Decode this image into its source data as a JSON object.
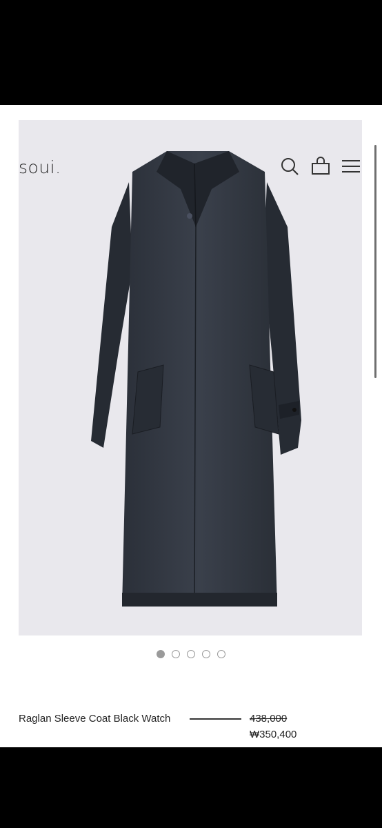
{
  "header": {
    "logo": "soui.",
    "icons": [
      "search-icon",
      "bag-icon",
      "menu-icon"
    ]
  },
  "gallery": {
    "total_images": 5,
    "active_index": 0
  },
  "product": {
    "name": "Raglan Sleeve Coat Black Watch",
    "original_price": "438,000",
    "sale_price": "₩350,400"
  },
  "colors": {
    "image_background": "#e9e8ed",
    "text": "#222222",
    "dot": "#9a9a9a"
  }
}
